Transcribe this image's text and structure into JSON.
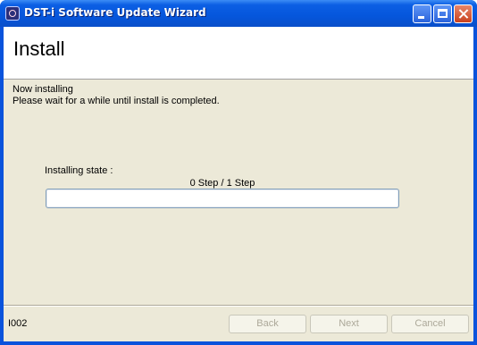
{
  "window": {
    "title": "DST-i Software Update Wizard"
  },
  "header": {
    "title": "Install"
  },
  "message": {
    "line1": "Now installing",
    "line2": "Please wait for a while until install is completed."
  },
  "progress": {
    "label": "Installing state :",
    "step_text": "0 Step / 1 Step",
    "fraction": 0
  },
  "footer": {
    "code": "I002",
    "back_label": "Back",
    "next_label": "Next",
    "cancel_label": "Cancel"
  },
  "colors": {
    "titlebar": "#0556dc",
    "dialog_bg": "#ece9d8",
    "progress_fill": "#2ebd1f",
    "disabled_text": "#aca899"
  }
}
